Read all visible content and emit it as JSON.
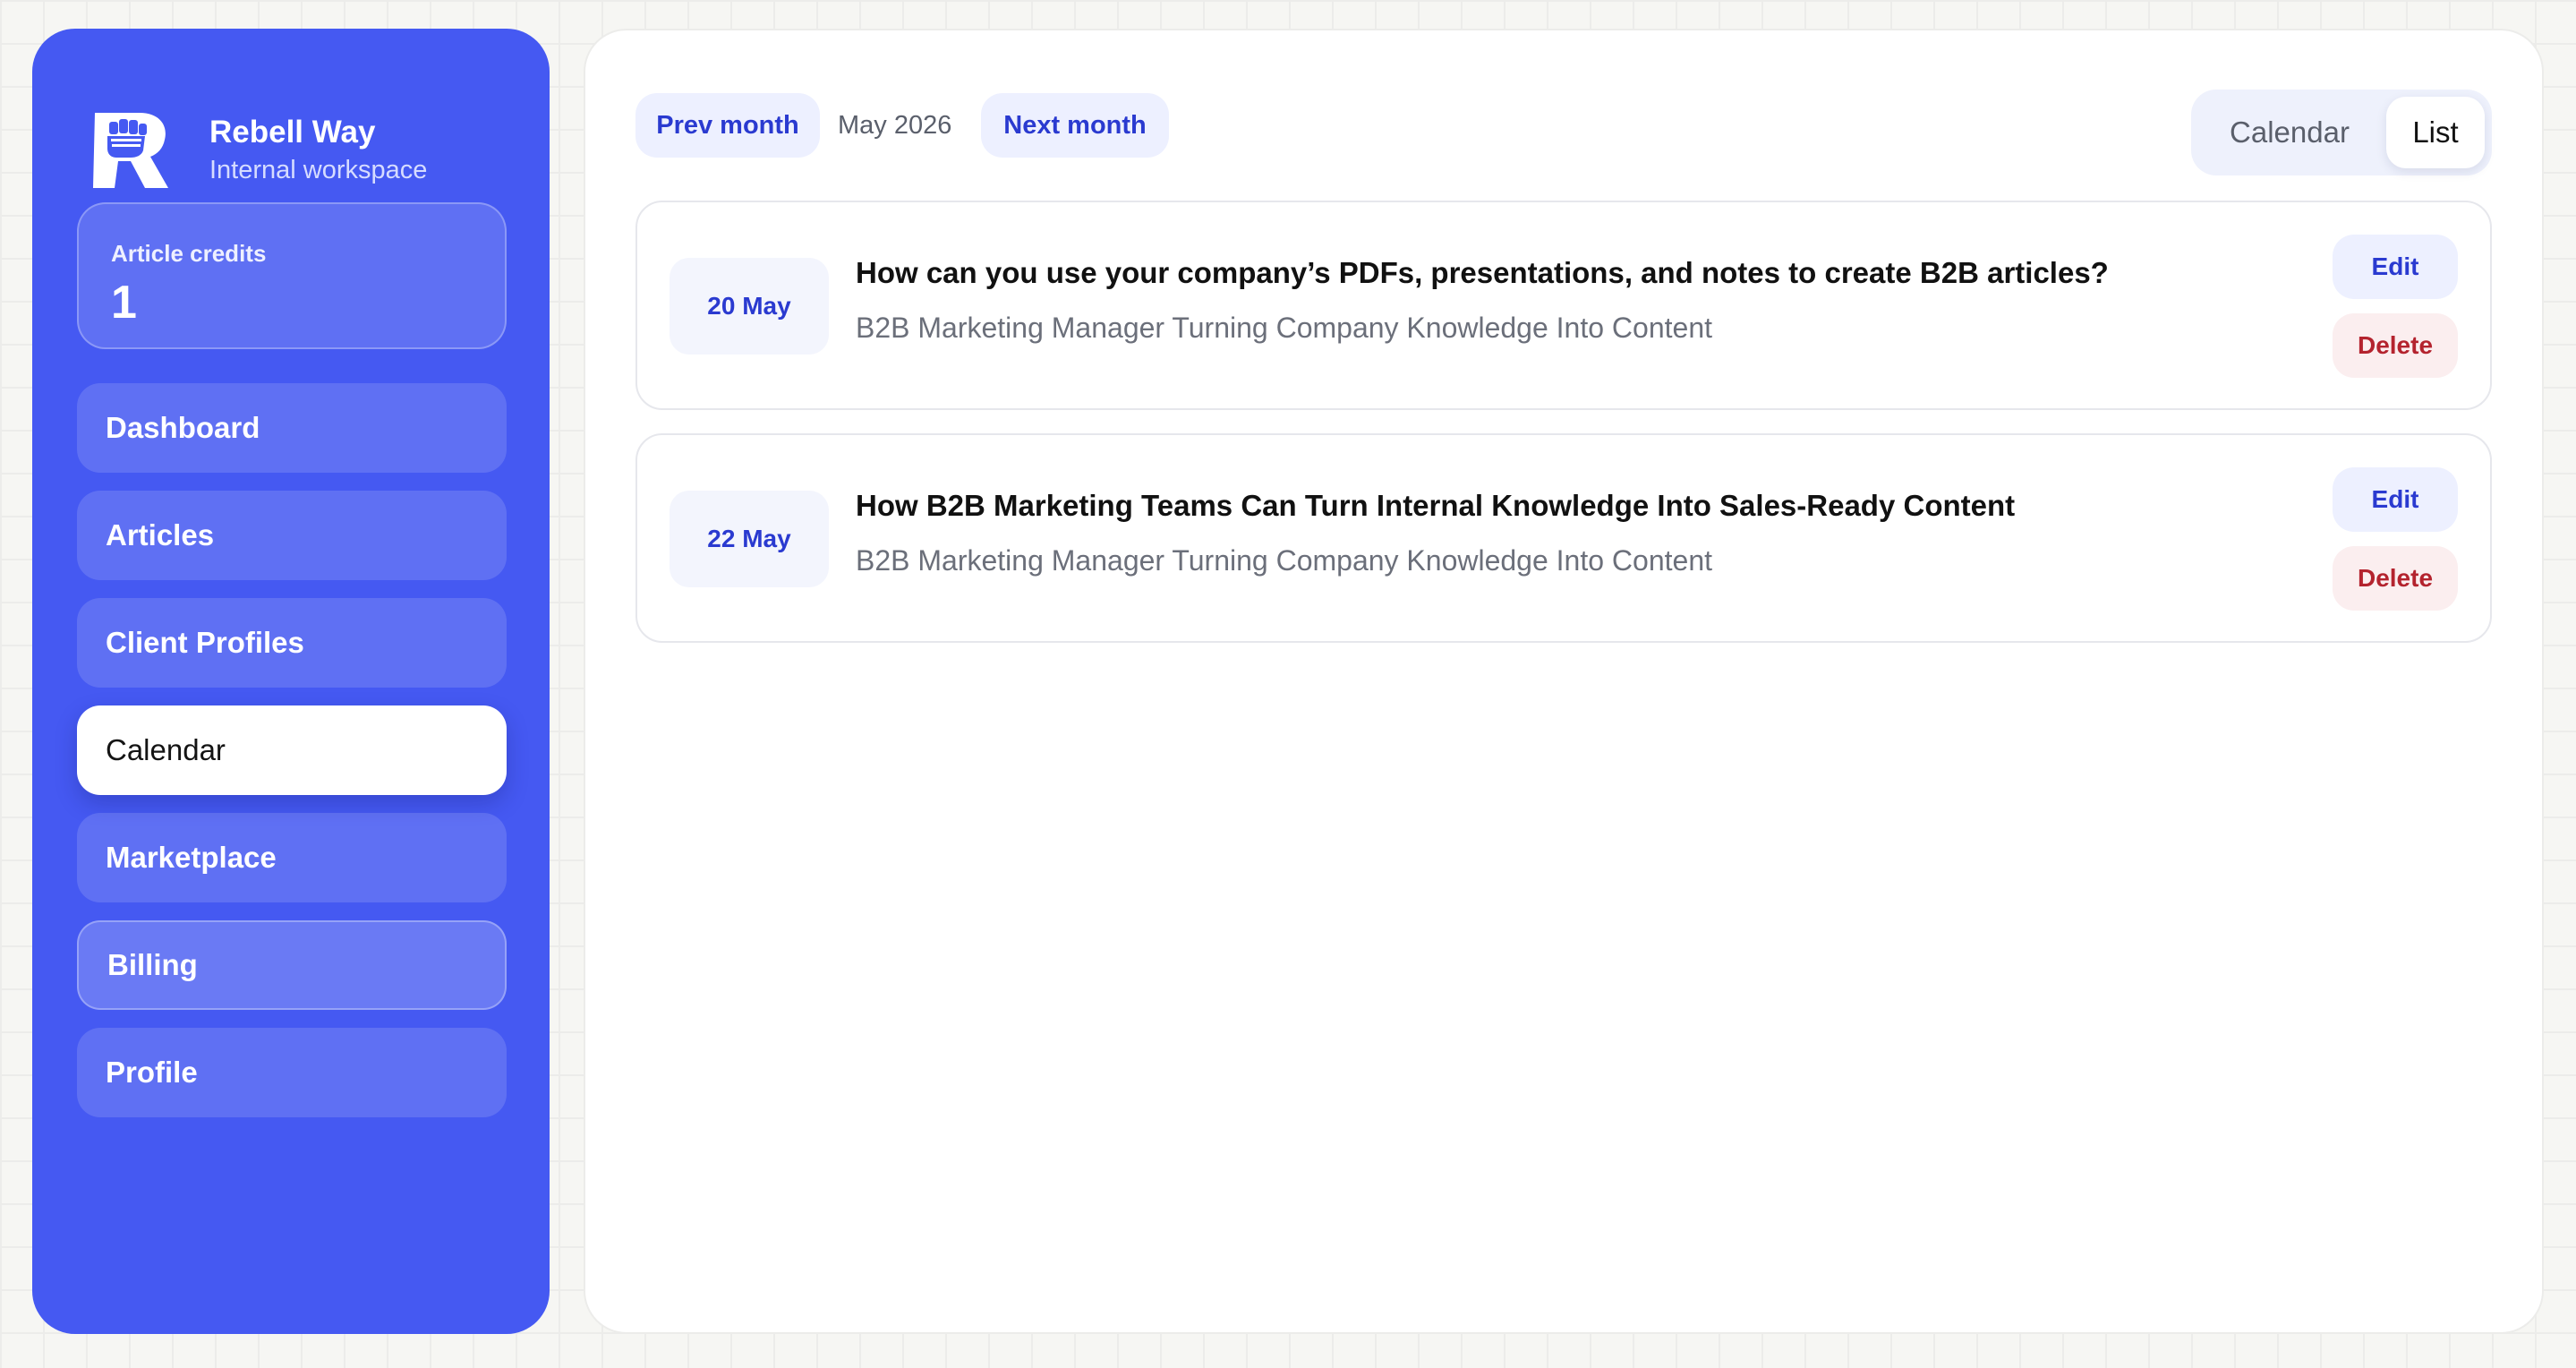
{
  "brand": {
    "name": "Rebell Way",
    "subtitle": "Internal workspace",
    "logo_icon": "fist-r-logo-icon"
  },
  "credits": {
    "label": "Article credits",
    "value": "1"
  },
  "nav": {
    "items": [
      {
        "label": "Dashboard",
        "active": false
      },
      {
        "label": "Articles",
        "active": false
      },
      {
        "label": "Client Profiles",
        "active": false
      },
      {
        "label": "Calendar",
        "active": true
      },
      {
        "label": "Marketplace",
        "active": false
      },
      {
        "label": "Billing",
        "active": false
      },
      {
        "label": "Profile",
        "active": false
      }
    ]
  },
  "toolbar": {
    "prev_label": "Prev month",
    "month": "May 2026",
    "next_label": "Next month"
  },
  "view_toggle": {
    "calendar_label": "Calendar",
    "list_label": "List",
    "selected": "List"
  },
  "articles": [
    {
      "date": "20 May",
      "title": "How can you use your company’s PDFs, presentations, and notes to create B2B articles?",
      "subtitle": "B2B Marketing Manager Turning Company Knowledge Into Content",
      "edit_label": "Edit",
      "delete_label": "Delete"
    },
    {
      "date": "22 May",
      "title": "How B2B Marketing Teams Can Turn Internal Knowledge Into Sales-Ready Content",
      "subtitle": "B2B Marketing Manager Turning Company Knowledge Into Content",
      "edit_label": "Edit",
      "delete_label": "Delete"
    }
  ],
  "colors": {
    "accent": "#4559f2",
    "link_blue": "#2a3ad0",
    "delete_red": "#b4232e",
    "background": "#f6f6f3"
  }
}
